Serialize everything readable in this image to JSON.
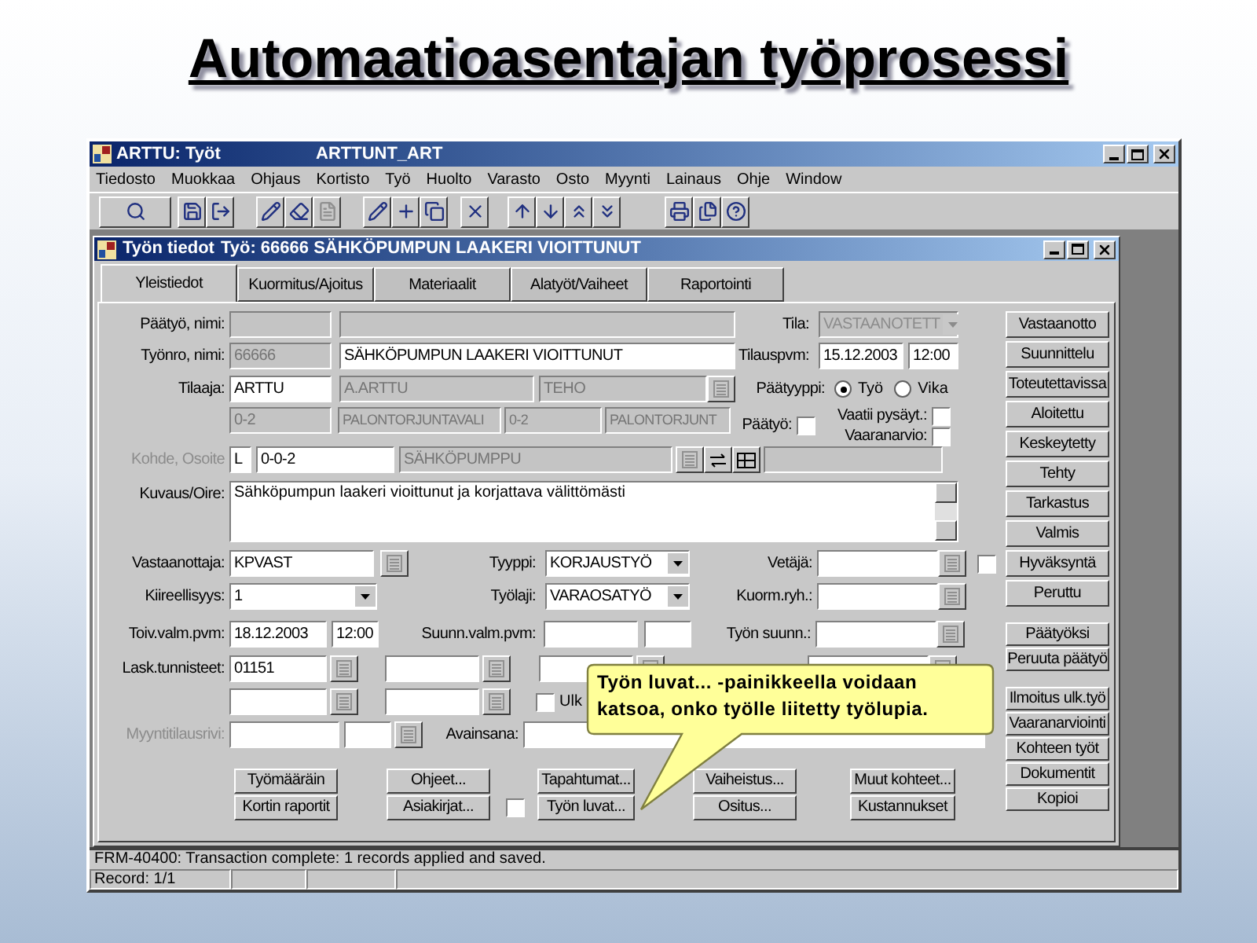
{
  "slide_title": "Automaatioasentajan työprosessi",
  "window": {
    "title": "ARTTU: Työt",
    "form_name": "ARTTUNT_ART"
  },
  "menu": [
    "Tiedosto",
    "Muokkaa",
    "Ohjaus",
    "Kortisto",
    "Työ",
    "Huolto",
    "Varasto",
    "Osto",
    "Myynti",
    "Lainaus",
    "Ohje",
    "Window"
  ],
  "form": {
    "title": "Työn tiedot",
    "record": "Työ: 66666 SÄHKÖPUMPUN LAAKERI VIOITTUNUT"
  },
  "tabs": [
    {
      "label": "Yleistiedot",
      "selected": true
    },
    {
      "label": "Kuormitus/Ajoitus",
      "selected": false
    },
    {
      "label": "Materiaalit",
      "selected": false
    },
    {
      "label": "Alatyöt/Vaiheet",
      "selected": false
    },
    {
      "label": "Raportointi",
      "selected": false
    }
  ],
  "paatyo": {
    "label": "Päätyö, nimi:",
    "fields": [
      {
        "disabled": true
      },
      {
        "disabled": true
      }
    ]
  },
  "tila": {
    "label": "Tila:",
    "value": "VASTAANOTETT",
    "disabled": true
  },
  "tyonro": {
    "label": "Työnro, nimi:",
    "fields": [
      {
        "value": "66666",
        "disabled": true
      },
      {
        "value": "SÄHKÖPUMPUN LAAKERI VIOITTUNUT",
        "disabled": false
      }
    ]
  },
  "tilauspvm": {
    "label": "Tilauspvm:",
    "fields": [
      {
        "value": "15.12.2003",
        "disabled": false
      },
      {
        "value": "12:00",
        "disabled": false
      }
    ]
  },
  "tilaaja": {
    "label": "Tilaaja:",
    "fields": [
      {
        "value": "ARTTU",
        "disabled": false
      },
      {
        "value": "A.ARTTU",
        "disabled": true
      },
      {
        "value": "TEHO",
        "disabled": true
      }
    ]
  },
  "tilaaja_row2": [
    {
      "value": "0-2",
      "disabled": true
    },
    {
      "value": "PALONTORJUNTAVALI",
      "disabled": true
    },
    {
      "value": "0-2",
      "disabled": true
    },
    {
      "value": "PALONTORJUNT",
      "disabled": true
    }
  ],
  "paatyyppi": {
    "label": "Päätyyppi:",
    "options": [
      {
        "label": "Työ",
        "selected": true
      },
      {
        "label": "Vika",
        "selected": false
      }
    ]
  },
  "checks": [
    {
      "label": "Päätyö:",
      "checked": false
    },
    {
      "label": "Vaatii pysäyt.:",
      "checked": false
    },
    {
      "label": "Vaaranarvio:",
      "checked": false
    }
  ],
  "kohde": {
    "label": "Kohde, Osoite",
    "disabled": true,
    "fields": [
      {
        "value": "L",
        "disabled": false
      },
      {
        "value": "0-0-2",
        "disabled": false
      },
      {
        "value": "SÄHKÖPUMPPU",
        "disabled": true
      },
      {
        "disabled": true
      }
    ]
  },
  "kuvaus": {
    "label": "Kuvaus/Oire:",
    "value": "Sähköpumpun laakeri vioittunut ja korjattava välittömästi"
  },
  "vastaanottaja": {
    "label": "Vastaanottaja:",
    "value": "KPVAST"
  },
  "tyyppi": {
    "label": "Tyyppi:",
    "value": "KORJAUSTYÖ"
  },
  "vetaja": {
    "label": "Vetäjä:"
  },
  "hyvaksynta_check": {
    "checked": false
  },
  "kiireellisyys": {
    "label": "Kiireellisyys:",
    "value": "1"
  },
  "tyolaji": {
    "label": "Työlaji:",
    "value": "VARAOSATYÖ"
  },
  "kuormryh": {
    "label": "Kuorm.ryh.:"
  },
  "toivvalm": {
    "label": "Toiv.valm.pvm:",
    "date": "18.12.2003",
    "time": "12:00"
  },
  "suunnvalm": {
    "label": "Suunn.valm.pvm:"
  },
  "tyonsuunn": {
    "label": "Työn suunn.:"
  },
  "lask": {
    "label": "Lask.tunnisteet:",
    "value": "01151"
  },
  "ulk": {
    "label": "Ulk",
    "checked": false
  },
  "myynti": {
    "label": "Myyntitilausrivi:",
    "disabled": true
  },
  "avainsana": {
    "label": "Avainsana:"
  },
  "bottom_buttons": [
    [
      "Työmääräin",
      "Kortin raportit"
    ],
    [
      "Ohjeet...",
      "Asiakirjat..."
    ],
    [
      "Tapahtumat...",
      "Työn luvat..."
    ],
    [
      "Vaiheistus...",
      "Ositus..."
    ],
    [
      "Muut kohteet...",
      "Kustannukset"
    ]
  ],
  "luvat_check": {
    "checked": false
  },
  "status_buttons": [
    [
      "Vastaanotto",
      "Suunnittelu",
      "Toteutettavissa",
      "Aloitettu",
      "Keskeytetty",
      "Tehty",
      "Tarkastus",
      "Valmis",
      "Hyväksyntä",
      "Peruttu"
    ],
    [
      "Päätyöksi",
      "Peruuta päätyö"
    ],
    [
      "Ilmoitus ulk.työ",
      "Vaaranarviointi",
      "Kohteen työt",
      "Dokumentit",
      "Kopioi"
    ]
  ],
  "callout": [
    "Työn luvat...  -painikkeella voidaan",
    "katsoa, onko työlle liitetty työlupia."
  ],
  "status_bar": {
    "message": "FRM-40400: Transaction complete: 1 records applied and saved.",
    "record": "Record: 1/1"
  }
}
